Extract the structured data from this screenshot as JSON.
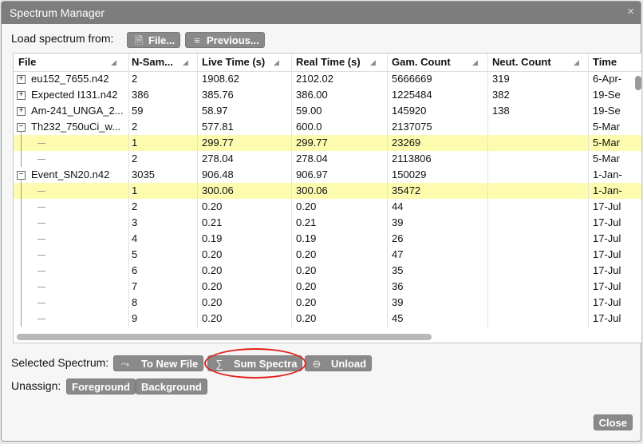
{
  "window": {
    "title": "Spectrum Manager",
    "close_glyph": "×"
  },
  "load": {
    "label": "Load spectrum from:",
    "file_button": "File...",
    "file_icon": "file-icon",
    "previous_button": "Previous...",
    "previous_icon": "database-icon"
  },
  "table": {
    "columns": [
      "File",
      "N-Sam...",
      "Live Time (s)",
      "Real Time (s)",
      "Gam. Count",
      "Neut. Count",
      "Time"
    ],
    "rows": [
      {
        "file": "eu152_7655.n42",
        "n": "2",
        "live": "1908.62",
        "real": "2102.02",
        "gam": "5666669",
        "neut": "319",
        "time": "6-Apr-",
        "level": 0,
        "toggle": "+",
        "selected": false
      },
      {
        "file": "Expected I131.n42",
        "n": "386",
        "live": "385.76",
        "real": "386.00",
        "gam": "1225484",
        "neut": "382",
        "time": "19-Se",
        "level": 0,
        "toggle": "+",
        "selected": false
      },
      {
        "file": "Am-241_UNGA_2...",
        "n": "59",
        "live": "58.97",
        "real": "59.00",
        "gam": "145920",
        "neut": "138",
        "time": "19-Se",
        "level": 0,
        "toggle": "+",
        "selected": false
      },
      {
        "file": "Th232_750uCi_w...",
        "n": "2",
        "live": "577.81",
        "real": "600.0",
        "gam": "2137075",
        "neut": "",
        "time": "5-Mar",
        "level": 0,
        "toggle": "−",
        "selected": false
      },
      {
        "file": "",
        "n": "1",
        "live": "299.77",
        "real": "299.77",
        "gam": "23269",
        "neut": "",
        "time": "5-Mar",
        "level": 1,
        "toggle": "",
        "selected": true
      },
      {
        "file": "",
        "n": "2",
        "live": "278.04",
        "real": "278.04",
        "gam": "2113806",
        "neut": "",
        "time": "5-Mar",
        "level": 1,
        "toggle": "",
        "selected": false
      },
      {
        "file": "Event_SN20.n42",
        "n": "3035",
        "live": "906.48",
        "real": "906.97",
        "gam": "150029",
        "neut": "",
        "time": "1-Jan-",
        "level": 0,
        "toggle": "−",
        "selected": false
      },
      {
        "file": "",
        "n": "1",
        "live": "300.06",
        "real": "300.06",
        "gam": "35472",
        "neut": "",
        "time": "1-Jan-",
        "level": 1,
        "toggle": "",
        "selected": true
      },
      {
        "file": "",
        "n": "2",
        "live": "0.20",
        "real": "0.20",
        "gam": "44",
        "neut": "",
        "time": "17-Jul",
        "level": 1,
        "toggle": "",
        "selected": false
      },
      {
        "file": "",
        "n": "3",
        "live": "0.21",
        "real": "0.21",
        "gam": "39",
        "neut": "",
        "time": "17-Jul",
        "level": 1,
        "toggle": "",
        "selected": false
      },
      {
        "file": "",
        "n": "4",
        "live": "0.19",
        "real": "0.19",
        "gam": "26",
        "neut": "",
        "time": "17-Jul",
        "level": 1,
        "toggle": "",
        "selected": false
      },
      {
        "file": "",
        "n": "5",
        "live": "0.20",
        "real": "0.20",
        "gam": "47",
        "neut": "",
        "time": "17-Jul",
        "level": 1,
        "toggle": "",
        "selected": false
      },
      {
        "file": "",
        "n": "6",
        "live": "0.20",
        "real": "0.20",
        "gam": "35",
        "neut": "",
        "time": "17-Jul",
        "level": 1,
        "toggle": "",
        "selected": false
      },
      {
        "file": "",
        "n": "7",
        "live": "0.20",
        "real": "0.20",
        "gam": "36",
        "neut": "",
        "time": "17-Jul",
        "level": 1,
        "toggle": "",
        "selected": false
      },
      {
        "file": "",
        "n": "8",
        "live": "0.20",
        "real": "0.20",
        "gam": "39",
        "neut": "",
        "time": "17-Jul",
        "level": 1,
        "toggle": "",
        "selected": false
      },
      {
        "file": "",
        "n": "9",
        "live": "0.20",
        "real": "0.20",
        "gam": "45",
        "neut": "",
        "time": "17-Jul",
        "level": 1,
        "toggle": "",
        "selected": false
      }
    ]
  },
  "selected": {
    "label": "Selected Spectrum:",
    "to_new_file": "To New File",
    "to_new_file_icon": "branch-arrow-icon",
    "sum_spectra": "Sum Spectra",
    "sum_icon": "sigma-icon",
    "unload": "Unload",
    "unload_icon": "minus-circle-icon"
  },
  "unassign": {
    "label": "Unassign:",
    "foreground": "Foreground",
    "background": "Background"
  },
  "footer": {
    "close": "Close"
  },
  "colors": {
    "titlebar": "#7d7d7d",
    "button": "#8a8a8a",
    "selected_row": "#fdfcae",
    "highlight_oval": "#e2241a"
  }
}
